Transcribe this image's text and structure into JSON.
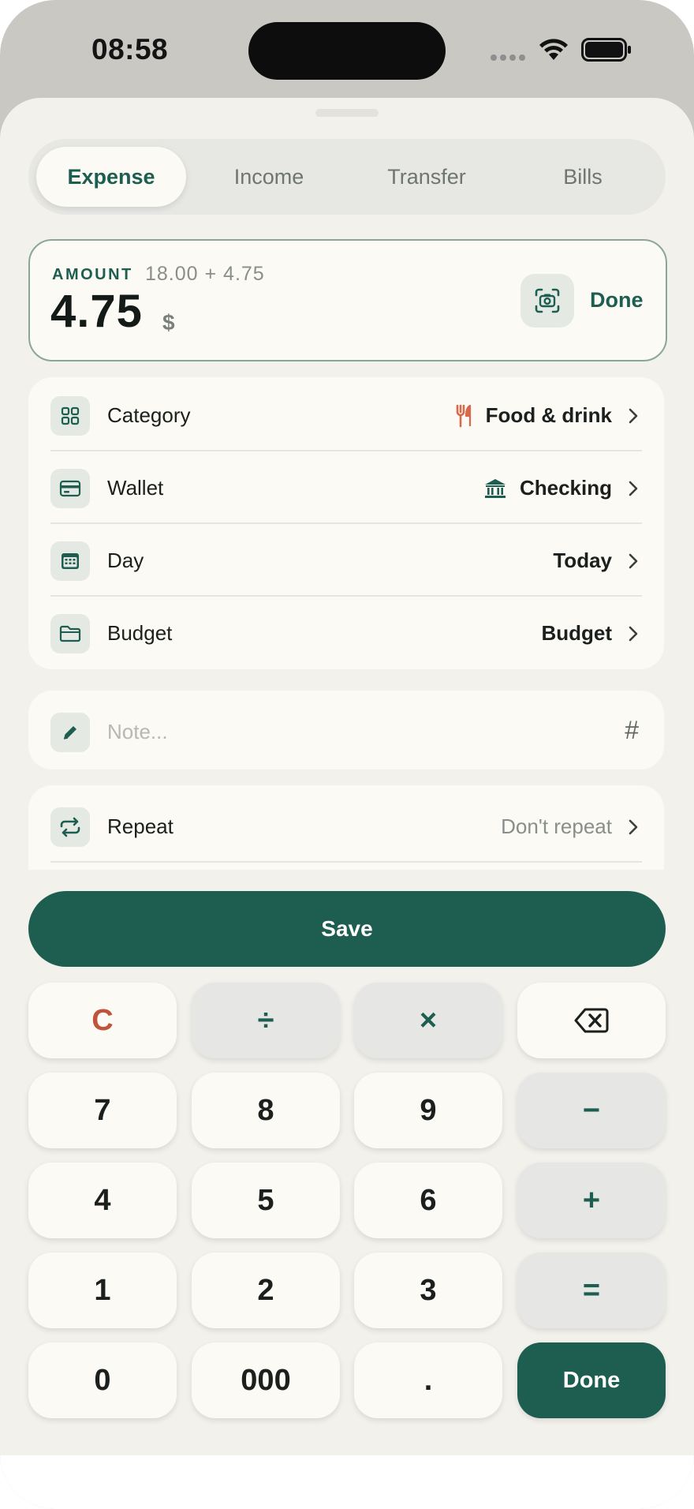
{
  "status_bar": {
    "time": "08:58"
  },
  "tabs": [
    {
      "label": "Expense",
      "active": true
    },
    {
      "label": "Income",
      "active": false
    },
    {
      "label": "Transfer",
      "active": false
    },
    {
      "label": "Bills",
      "active": false
    }
  ],
  "amount": {
    "label": "AMOUNT",
    "expression": "18.00 + 4.75",
    "value": "4.75",
    "currency": "$",
    "scan_icon": "camera-scan-icon",
    "done_label": "Done"
  },
  "details": [
    {
      "label": "Category",
      "value": "Food & drink",
      "icon": "grid-icon",
      "value_icon": "fork-knife-icon",
      "value_icon_color": "#d8694a"
    },
    {
      "label": "Wallet",
      "value": "Checking",
      "icon": "card-icon",
      "value_icon": "bank-icon",
      "value_icon_color": "#1d5e51"
    },
    {
      "label": "Day",
      "value": "Today",
      "icon": "calendar-icon"
    },
    {
      "label": "Budget",
      "value": "Budget",
      "icon": "folder-icon"
    }
  ],
  "note": {
    "placeholder": "Note...",
    "tag_symbol": "#",
    "icon": "pencil-icon"
  },
  "repeat": {
    "label": "Repeat",
    "value": "Don't repeat",
    "icon": "repeat-icon"
  },
  "save_label": "Save",
  "keypad": {
    "row1": [
      "C",
      "÷",
      "×",
      "⌫"
    ],
    "row2": [
      "7",
      "8",
      "9",
      "−"
    ],
    "row3": [
      "4",
      "5",
      "6",
      "+"
    ],
    "row4": [
      "1",
      "2",
      "3",
      "="
    ],
    "row5": [
      "0",
      "000",
      ".",
      "Done"
    ]
  },
  "colors": {
    "accent": "#1d5e51",
    "clear_key": "#c0533b",
    "surface": "#fbfaf4",
    "sheet_bg": "#f2f1ec"
  }
}
